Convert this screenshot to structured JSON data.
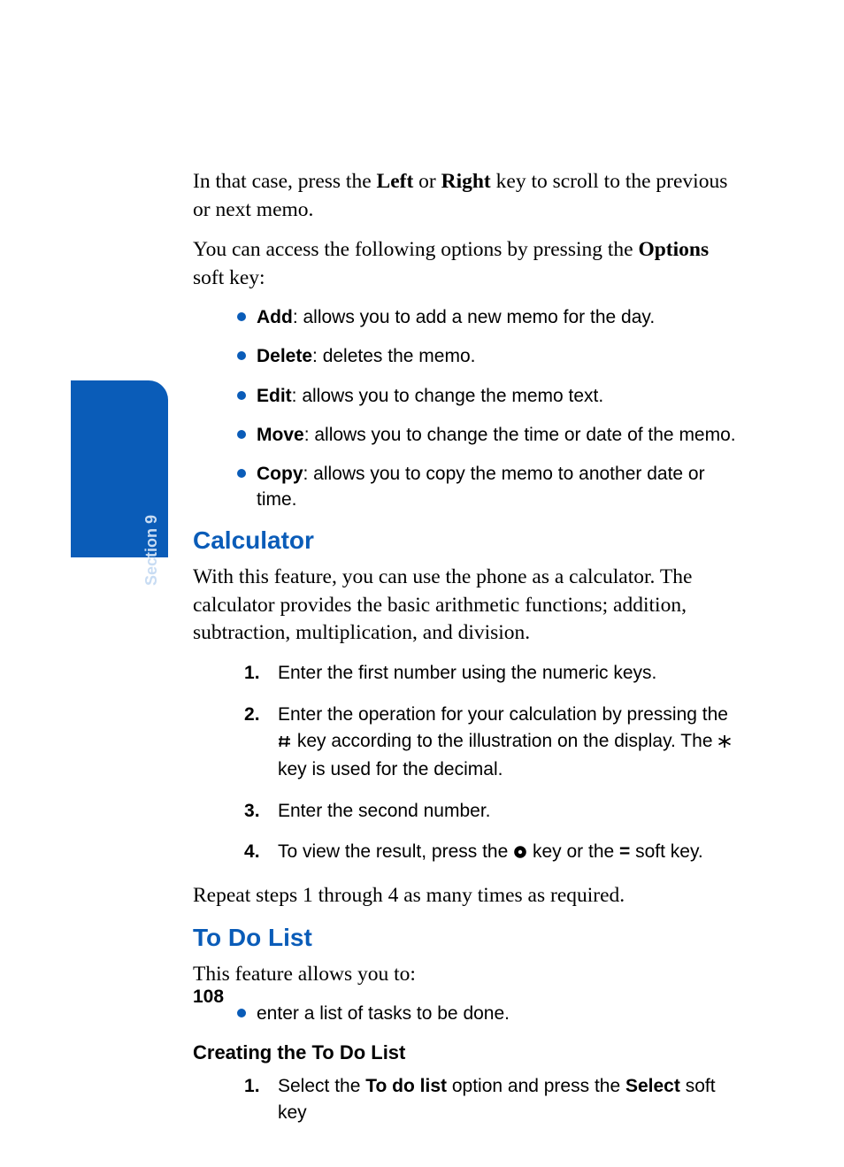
{
  "section_tab": {
    "label": "Section 9"
  },
  "p1": {
    "t1": "In that case, press the ",
    "b1": "Left",
    "t2": " or ",
    "b2": "Right",
    "t3": " key to scroll to the previous or next memo."
  },
  "p2": {
    "t1": "You can access the following options by pressing the ",
    "b1": "Options",
    "t2": " soft key:"
  },
  "bullets1": [
    {
      "bold": "Add",
      "rest": ": allows you to add a new memo for the day."
    },
    {
      "bold": "Delete",
      "rest": ": deletes the memo."
    },
    {
      "bold": "Edit",
      "rest": ": allows you to change the memo text."
    },
    {
      "bold": "Move",
      "rest": ": allows you to change the time or date of the memo."
    },
    {
      "bold": "Copy",
      "rest": ": allows you to copy the memo to another date or time."
    }
  ],
  "h_calc": "Calculator",
  "p_calc": "With this feature, you can use the phone as a calculator. The calculator provides the basic arithmetic functions; addition, subtraction, multiplication, and division.",
  "steps_calc": {
    "s1": "Enter the first number using the numeric keys.",
    "s2a": "Enter the operation for your calculation by pressing the ",
    "s2b": " key according to the illustration on the display. The ",
    "s2c": " key is used for the decimal.",
    "s3": "Enter the second number.",
    "s4a": "To view the result, press the ",
    "s4b": " key or the ",
    "s4eq": "=",
    "s4c": " soft key."
  },
  "p_repeat": "Repeat steps 1 through 4 as many times as required.",
  "h_todo": "To Do List",
  "p_todo_intro": "This feature allows you to:",
  "bullets2": [
    {
      "text": "enter a list of tasks to be done."
    }
  ],
  "h_creating": "Creating the To Do List",
  "steps_todo": {
    "s1a": "Select the ",
    "s1b1": "To do list",
    "s1c": " option and press the ",
    "s1b2": "Select",
    "s1d": " soft key"
  },
  "page_number": "108"
}
